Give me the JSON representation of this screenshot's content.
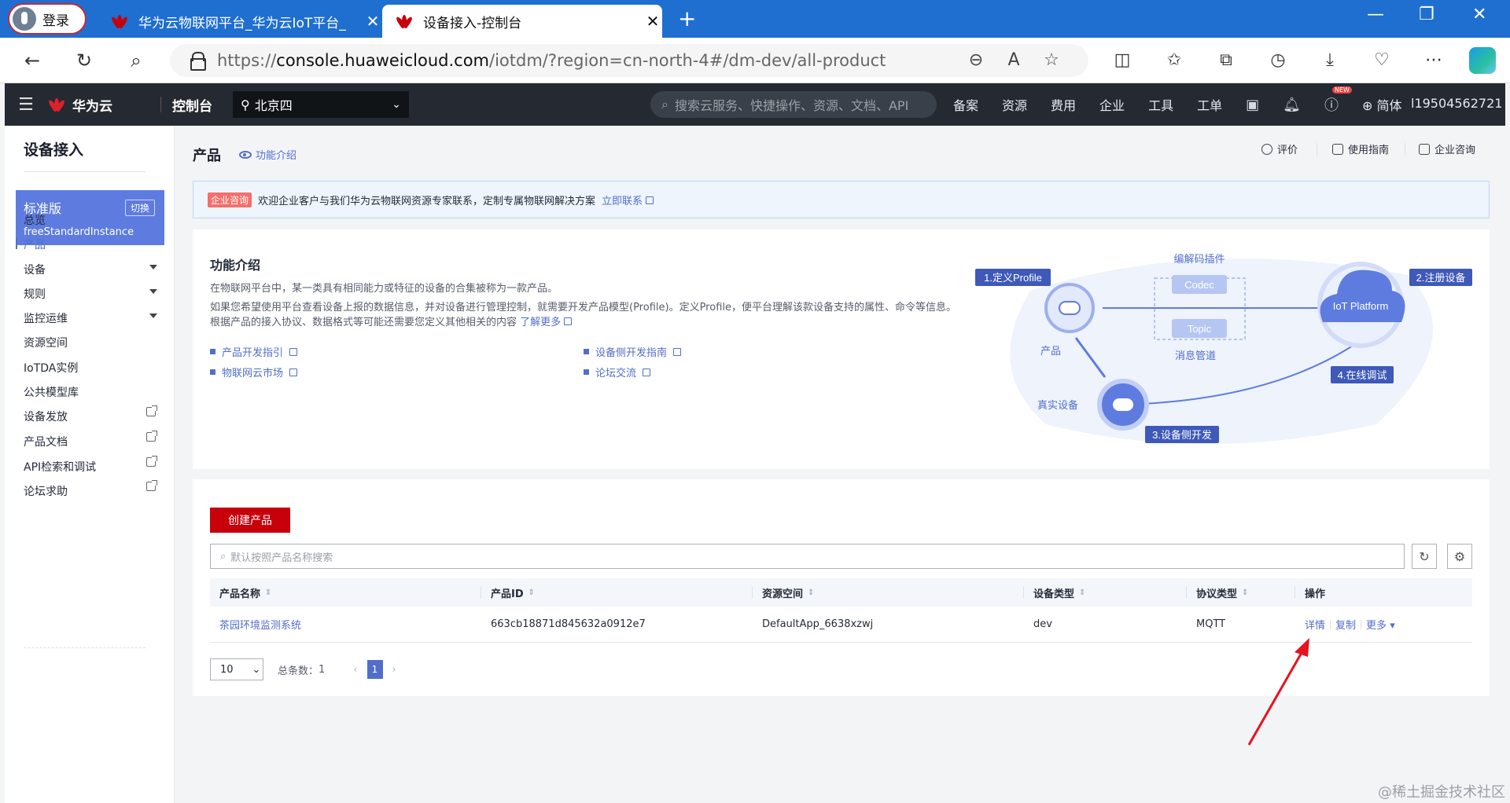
{
  "browser": {
    "login_label": "登录",
    "tabs": [
      {
        "title": "华为云物联网平台_华为云IoT平台_"
      },
      {
        "title": "设备接入-控制台"
      }
    ],
    "url_prefix": "https://",
    "url_host": "console.huaweicloud.com",
    "url_path": "/iotdm/?region=cn-north-4#/dm-dev/all-product"
  },
  "console": {
    "brand": "华为云",
    "console_label": "控制台",
    "region": "北京四",
    "search_placeholder": "搜索云服务、快捷操作、资源、文档、API",
    "menu": [
      "备案",
      "资源",
      "费用",
      "企业",
      "工具",
      "工单"
    ],
    "new_badge": "NEW",
    "lang": "简体",
    "user": "l19504562721"
  },
  "sidebar": {
    "title": "设备接入",
    "edition_name": "标准版",
    "edition_switch": "切换",
    "instance": "freeStandardInstance",
    "items": [
      {
        "label": "总览"
      },
      {
        "label": "产品"
      },
      {
        "label": "设备"
      },
      {
        "label": "规则"
      },
      {
        "label": "监控运维"
      },
      {
        "label": "资源空间"
      },
      {
        "label": "IoTDA实例"
      },
      {
        "label": "公共模型库"
      },
      {
        "label": "设备发放"
      },
      {
        "label": "产品文档"
      },
      {
        "label": "API检索和调试"
      },
      {
        "label": "论坛求助"
      }
    ]
  },
  "page": {
    "title": "产品",
    "intro_link": "功能介绍",
    "actions": [
      "评价",
      "使用指南",
      "企业咨询"
    ]
  },
  "banner": {
    "tag": "企业咨询",
    "text": "欢迎企业客户与我们华为云物联网资源专家联系，定制专属物联网解决方案",
    "link": "立即联系"
  },
  "intro": {
    "title": "功能介绍",
    "desc1": "在物联网平台中，某一类具有相同能力或特征的设备的合集被称为一款产品。",
    "desc2": "如果您希望使用平台查看设备上报的数据信息，并对设备进行管理控制，就需要开发产品模型(Profile)。定义Profile，便平台理解该款设备支持的属性、命令等信息。根据产品的接入协议、数据格式等可能还需要您定义其他相关的内容",
    "more": "了解更多",
    "links": [
      "产品开发指引",
      "物联网云市场",
      "设备侧开发指南",
      "论坛交流"
    ],
    "diagram": {
      "steps": [
        "1.定义Profile",
        "2.注册设备",
        "3.设备侧开发",
        "4.在线调试"
      ],
      "labels": [
        "编解码插件",
        "Codec",
        "Topic",
        "消息管道",
        "产品",
        "真实设备",
        "IoT Platform"
      ]
    }
  },
  "list": {
    "create_button": "创建产品",
    "search_placeholder": "默认按照产品名称搜索",
    "columns": [
      "产品名称",
      "产品ID",
      "资源空间",
      "设备类型",
      "协议类型",
      "操作"
    ],
    "rows": [
      {
        "name": "茶园环境监测系统",
        "id": "663cb18871d845632a0912e7",
        "space": "DefaultApp_6638xzwj",
        "type": "dev",
        "protocol": "MQTT",
        "ops": [
          "详情",
          "复制",
          "更多"
        ]
      }
    ],
    "page_size": "10",
    "total_label": "总条数：",
    "total": "1",
    "current_page": "1"
  },
  "watermark": "@稀土掘金技术社区",
  "colors": {
    "brand_red": "#c7000b",
    "link_blue": "#526ecc",
    "browser_blue": "#1e6fd0",
    "console_dark": "#252a32"
  }
}
